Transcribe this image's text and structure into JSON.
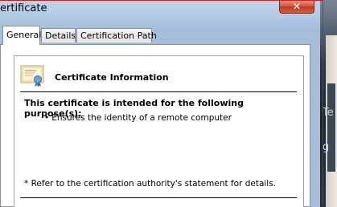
{
  "window": {
    "title": "ertificate",
    "close_label": "✕"
  },
  "tabs": [
    {
      "label": "General",
      "active": true
    },
    {
      "label": "Details",
      "active": false
    },
    {
      "label": "Certification Path",
      "active": false
    }
  ],
  "certificate": {
    "heading": "Certificate Information",
    "icon": "certificate-icon",
    "purpose_title": "This certificate is intended for the following purpose(s):",
    "purposes": [
      "Ensures the identity of a remote computer"
    ],
    "footnote": "* Refer to the certification authority's statement for details."
  },
  "background_window": {
    "peek_chars": [
      "Te",
      "g"
    ]
  },
  "colors": {
    "frame": "#b6cce6",
    "close_button": "#c23a23",
    "highlight_outline": "#c81f1f"
  }
}
